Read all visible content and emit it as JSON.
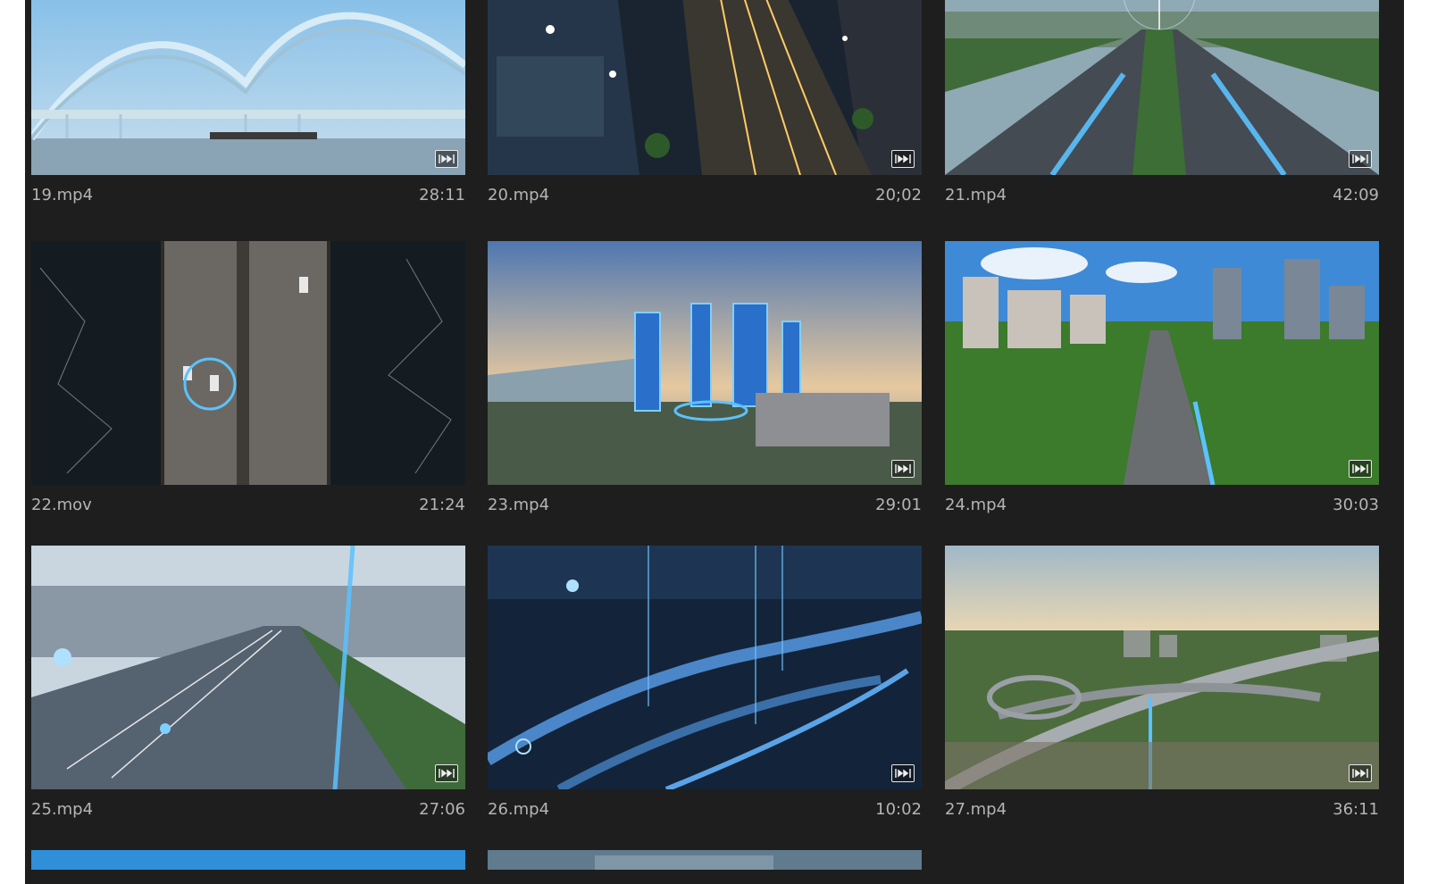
{
  "clips": [
    {
      "name": "19.mp4",
      "duration": "28:11",
      "scene": "bridge"
    },
    {
      "name": "20.mp4",
      "duration": "20;02",
      "scene": "night-city"
    },
    {
      "name": "21.mp4",
      "duration": "42:09",
      "scene": "highway-tech"
    },
    {
      "name": "22.mov",
      "duration": "21:24",
      "scene": "bridge-topdown"
    },
    {
      "name": "23.mp4",
      "duration": "29:01",
      "scene": "skyline-towers"
    },
    {
      "name": "24.mp4",
      "duration": "30:03",
      "scene": "green-city"
    },
    {
      "name": "25.mp4",
      "duration": "27:06",
      "scene": "freeway-blue"
    },
    {
      "name": "26.mp4",
      "duration": "10:02",
      "scene": "interchange-blue"
    },
    {
      "name": "27.mp4",
      "duration": "36:11",
      "scene": "interchange-dusk"
    }
  ],
  "partial_row": [
    "sky-blue",
    "city-top"
  ],
  "badge_icon": "timeline-clip-icon",
  "colors": {
    "panel_bg": "#1e1e1e",
    "meta_text": "#b4b4b4",
    "accent_glow": "#3aa0ff"
  }
}
